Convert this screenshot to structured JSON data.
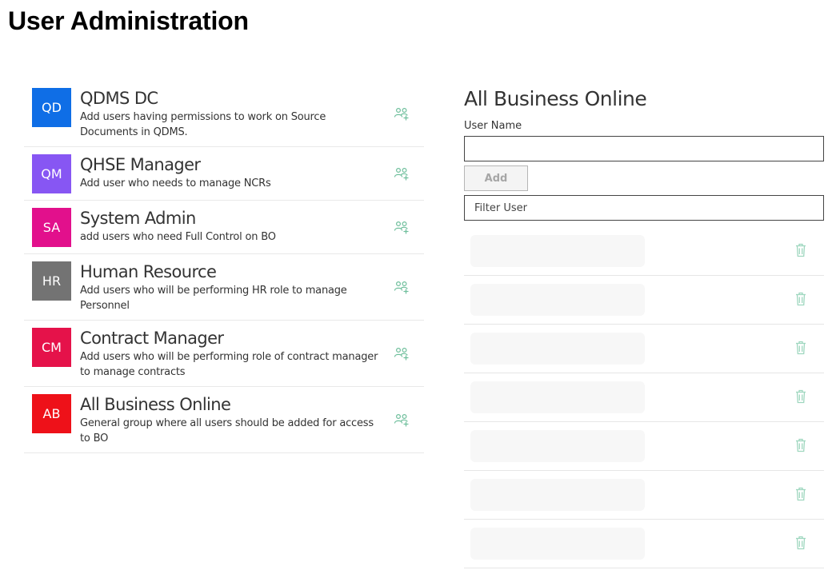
{
  "page": {
    "title": "User Administration"
  },
  "colors": {
    "accent_icon": "#6fbf9c",
    "delete_icon": "#9fd7bf"
  },
  "groups": [
    {
      "initials": "QD",
      "color": "#0f6ee6",
      "name": "QDMS DC",
      "description": "Add users having permissions to work on Source Documents in QDMS.",
      "icon": "people-add-icon"
    },
    {
      "initials": "QM",
      "color": "#8756f3",
      "name": "QHSE Manager",
      "description": "Add user who needs to manage NCRs",
      "icon": "people-add-icon"
    },
    {
      "initials": "SA",
      "color": "#e2108c",
      "name": "System Admin",
      "description": "add users who need Full Control on BO",
      "icon": "people-add-icon"
    },
    {
      "initials": "HR",
      "color": "#737373",
      "name": "Human Resource",
      "description": "Add users who will be performing HR role to manage Personnel",
      "icon": "people-add-icon"
    },
    {
      "initials": "CM",
      "color": "#e5124a",
      "name": "Contract Manager",
      "description": "Add users who will be performing role of contract manager to manage contracts",
      "icon": "people-add-icon"
    },
    {
      "initials": "AB",
      "color": "#ee1119",
      "name": "All Business Online",
      "description": "General group where all users should be added for access to BO",
      "icon": "people-add-icon"
    }
  ],
  "panel": {
    "title": "All Business Online",
    "user_name_label": "User Name",
    "user_name_value": "",
    "add_label": "Add",
    "filter_placeholder": "Filter User",
    "users": [
      {
        "name": "",
        "icon": "trash-icon"
      },
      {
        "name": "",
        "icon": "trash-icon"
      },
      {
        "name": "",
        "icon": "trash-icon"
      },
      {
        "name": "",
        "icon": "trash-icon"
      },
      {
        "name": "",
        "icon": "trash-icon"
      },
      {
        "name": "",
        "icon": "trash-icon"
      },
      {
        "name": "",
        "icon": "trash-icon"
      }
    ]
  }
}
